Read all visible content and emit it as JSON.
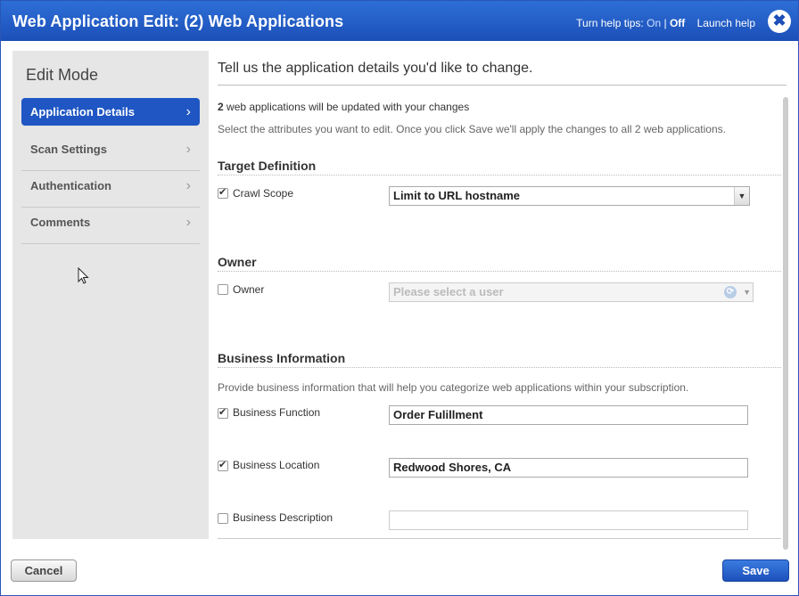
{
  "window": {
    "title": "Web Application Edit: (2) Web Applications",
    "help_prefix": "Turn help tips:",
    "help_on": "On",
    "help_sep": "|",
    "help_off": "Off",
    "launch_help": "Launch help",
    "close_glyph": "✖"
  },
  "sidebar": {
    "title": "Edit Mode",
    "items": [
      {
        "label": "Application Details",
        "active": true
      },
      {
        "label": "Scan Settings",
        "active": false
      },
      {
        "label": "Authentication",
        "active": false
      },
      {
        "label": "Comments",
        "active": false
      }
    ]
  },
  "main": {
    "heading": "Tell us the application details you'd like to change.",
    "count": "2",
    "count_suffix": "web applications will be updated with your changes",
    "instructions": "Select the attributes you want to edit. Once you click Save we'll apply the changes to all 2 web applications."
  },
  "target_definition": {
    "title": "Target Definition",
    "crawl_scope_label": "Crawl Scope",
    "crawl_scope_checked": true,
    "crawl_scope_value": "Limit to URL hostname"
  },
  "owner": {
    "title": "Owner",
    "owner_label": "Owner",
    "owner_checked": false,
    "placeholder": "Please select a user"
  },
  "business": {
    "title": "Business Information",
    "instructions": "Provide business information that will help you categorize web applications within your subscription.",
    "function_label": "Business Function",
    "function_checked": true,
    "function_value": "Order Fulillment",
    "location_label": "Business Location",
    "location_checked": true,
    "location_value": "Redwood Shores, CA",
    "description_label": "Business Description",
    "description_checked": false,
    "description_value": ""
  },
  "footer": {
    "cancel_label": "Cancel",
    "save_label": "Save"
  },
  "colors": {
    "titlebar": "#1c4fb8",
    "active_nav": "#1f56c3",
    "sidebar_bg": "#e6e6e6"
  },
  "icons": [
    "close-icon",
    "chevron-right-icon",
    "checkbox-icon",
    "dropdown-arrow-icon",
    "refresh-icon",
    "mouse-cursor-icon"
  ]
}
